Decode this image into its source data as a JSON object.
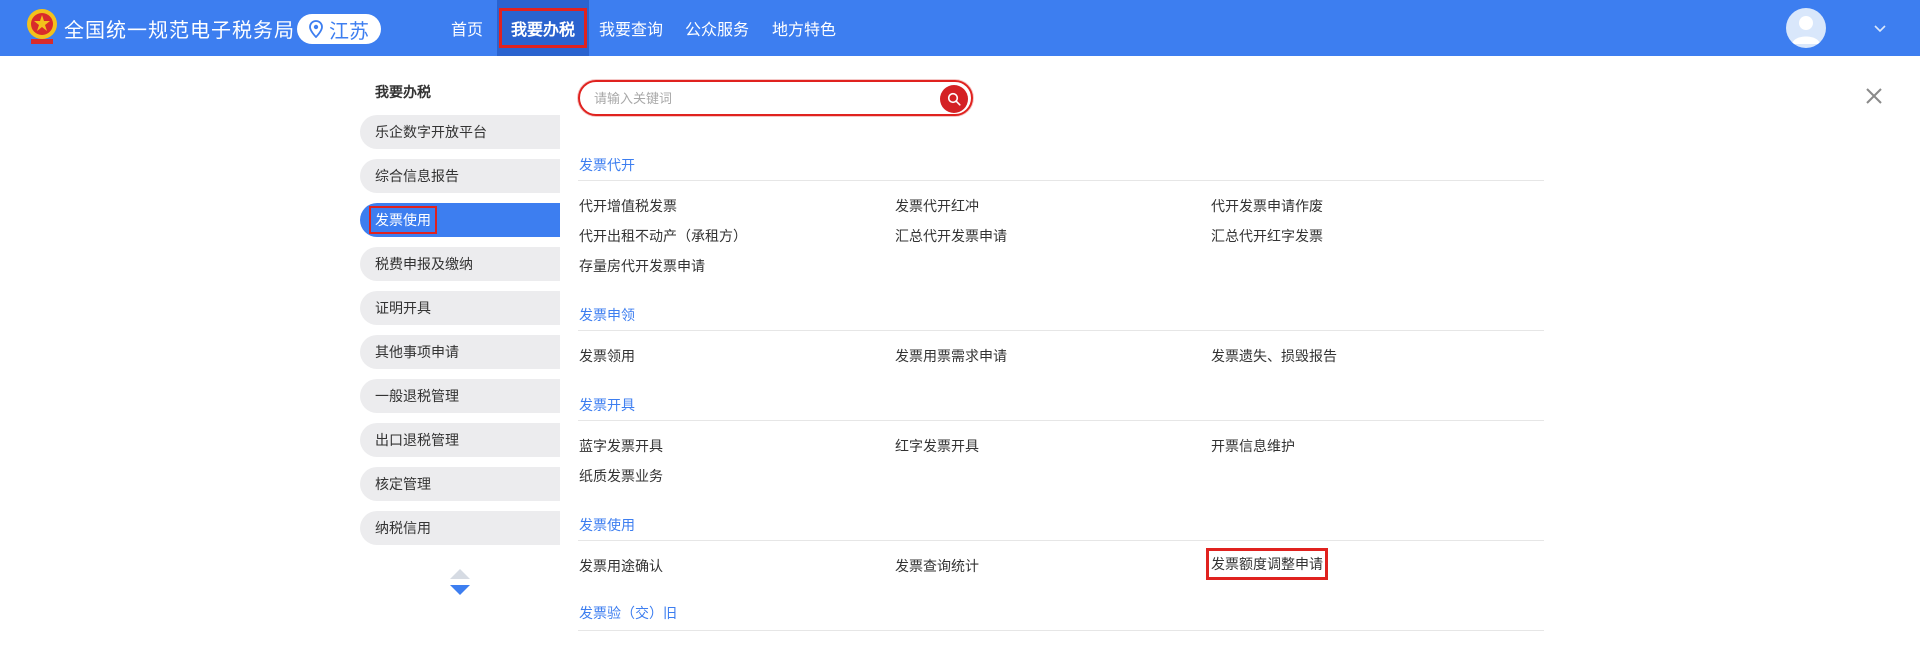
{
  "header": {
    "site_title": "全国统一规范电子税务局",
    "region": "江苏",
    "nav": [
      "首页",
      "我要办税",
      "我要查询",
      "公众服务",
      "地方特色"
    ]
  },
  "sidebar": {
    "title": "我要办税",
    "items": [
      "乐企数字开放平台",
      "综合信息报告",
      "发票使用",
      "税费申报及缴纳",
      "证明开具",
      "其他事项申请",
      "一般退税管理",
      "出口退税管理",
      "核定管理",
      "纳税信用"
    ]
  },
  "search": {
    "placeholder": "请输入关键词",
    "value": ""
  },
  "sections": [
    {
      "title": "发票代开",
      "links": [
        "代开增值税发票",
        "发票代开红冲",
        "代开发票申请作废",
        "代开出租不动产（承租方）",
        "汇总代开发票申请",
        "汇总代开红字发票",
        "存量房代开发票申请"
      ]
    },
    {
      "title": "发票申领",
      "links": [
        "发票领用",
        "发票用票需求申请",
        "发票遗失、损毁报告"
      ]
    },
    {
      "title": "发票开具",
      "links": [
        "蓝字发票开具",
        "红字发票开具",
        "开票信息维护",
        "纸质发票业务"
      ]
    },
    {
      "title": "发票使用",
      "links": [
        "发票用途确认",
        "发票查询统计",
        "发票额度调整申请"
      ]
    },
    {
      "title": "发票验（交）旧",
      "links": []
    }
  ],
  "colors": {
    "brand": "#3d7ef0",
    "highlight": "#e0221f",
    "search_button": "#d42124"
  },
  "icons": {
    "region": "location-pin-icon",
    "search": "search-icon",
    "close": "close-icon",
    "user": "user-avatar-icon",
    "dropdown": "chevron-down-icon",
    "scroll": "scroll-arrows-icon"
  }
}
